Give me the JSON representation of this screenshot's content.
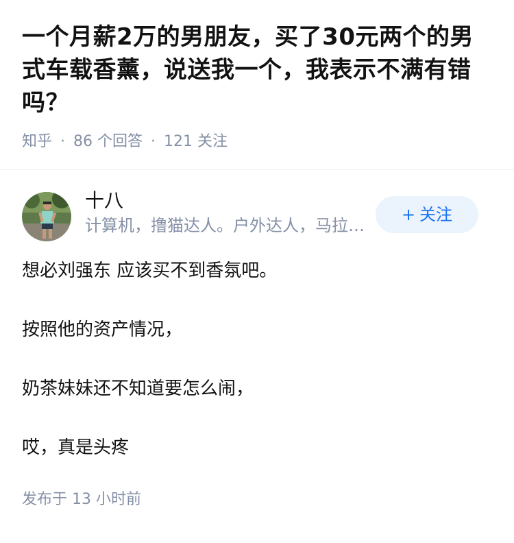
{
  "question": {
    "title": "一个月薪2万的男朋友，买了30元两个的男式车载香薰，说送我一个，我表示不满有错吗？",
    "source": "知乎",
    "separator": "·",
    "answers_count": "86",
    "answers_label": "个回答",
    "followers_count": "121",
    "followers_label": "关注"
  },
  "answer": {
    "author": {
      "name": "十八",
      "bio": "计算机，撸猫达人。户外达人，马拉松爱好者",
      "avatar_icon": "runner-photo-avatar"
    },
    "follow_button": {
      "plus": "+",
      "label": "关注"
    },
    "paragraphs": [
      "想必刘强东 应该买不到香氛吧。",
      "按照他的资产情况，",
      "奶茶妹妹还不知道要怎么闹，",
      "哎，真是头疼"
    ],
    "publish": {
      "prefix": "发布于",
      "count": "13",
      "unit": "小时前"
    }
  },
  "colors": {
    "meta_gray": "#8590a6",
    "follow_blue": "#1772f6",
    "follow_bg": "#ebf3fc",
    "text": "#121212"
  }
}
